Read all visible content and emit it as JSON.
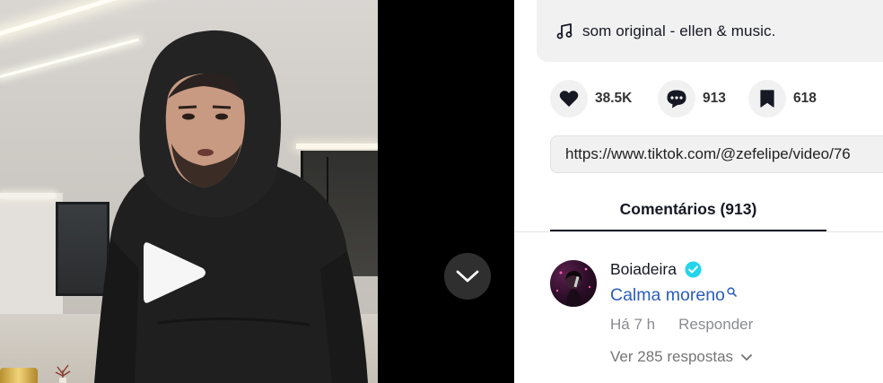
{
  "video": {
    "play_icon": "play-icon"
  },
  "nav": {
    "down_icon": "chevron-down-icon"
  },
  "music": {
    "icon": "music-note-icon",
    "text": "som original - ellen & music."
  },
  "stats": {
    "likes": {
      "icon": "heart-icon",
      "count": "38.5K"
    },
    "comments": {
      "icon": "comment-icon",
      "count": "913"
    },
    "saves": {
      "icon": "bookmark-icon",
      "count": "618"
    }
  },
  "share": {
    "link": "https://www.tiktok.com/@zefelipe/video/76"
  },
  "tabs": {
    "comments_label": "Comentários (913)"
  },
  "comment": {
    "username": "Boiadeira",
    "verified_icon": "verified-badge-icon",
    "text": "Calma moreno",
    "search_icon": "search-icon",
    "time": "Há 7 h",
    "reply_label": "Responder",
    "view_replies": "Ver 285 respostas",
    "replies_icon": "chevron-down-icon"
  },
  "colors": {
    "text_primary": "#161823",
    "link_blue": "#2b5db9",
    "muted": "#8a8b91",
    "pill_bg": "#f1f1f2",
    "verified": "#20d5ec"
  }
}
